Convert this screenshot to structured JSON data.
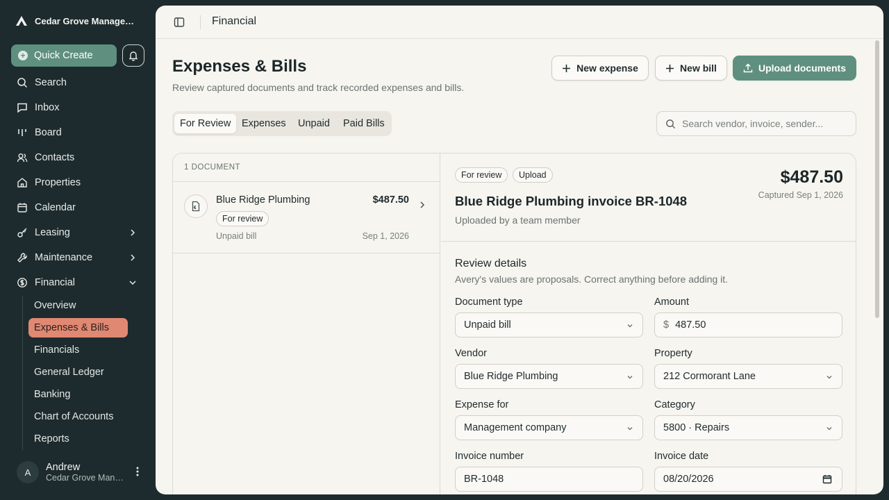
{
  "sidebar": {
    "brand": "Cedar Grove Management",
    "quick_create": "Quick Create",
    "nav": [
      {
        "label": "Search",
        "icon": "search-icon"
      },
      {
        "label": "Inbox",
        "icon": "inbox-icon"
      },
      {
        "label": "Board",
        "icon": "board-icon"
      },
      {
        "label": "Contacts",
        "icon": "contacts-icon"
      },
      {
        "label": "Properties",
        "icon": "home-icon"
      },
      {
        "label": "Calendar",
        "icon": "calendar-icon"
      },
      {
        "label": "Leasing",
        "icon": "key-icon"
      },
      {
        "label": "Maintenance",
        "icon": "wrench-icon"
      },
      {
        "label": "Financial",
        "icon": "dollar-icon"
      }
    ],
    "financial_sub": [
      "Overview",
      "Expenses & Bills",
      "Financials",
      "General Ledger",
      "Banking",
      "Chart of Accounts",
      "Reports"
    ],
    "user": {
      "initial": "A",
      "name": "Andrew",
      "org": "Cedar Grove Management"
    }
  },
  "topbar": {
    "title": "Financial"
  },
  "page": {
    "title": "Expenses & Bills",
    "subtitle": "Review captured documents and track recorded expenses and bills.",
    "buttons": {
      "new_expense": "New expense",
      "new_bill": "New bill",
      "upload": "Upload documents"
    },
    "tabs": [
      "For Review",
      "Expenses",
      "Unpaid",
      "Paid Bills"
    ],
    "search_placeholder": "Search vendor, invoice, sender..."
  },
  "list": {
    "header": "1 DOCUMENT",
    "items": [
      {
        "vendor": "Blue Ridge Plumbing",
        "amount": "$487.50",
        "status": "For review",
        "type": "Unpaid bill",
        "date": "Sep 1, 2026"
      }
    ]
  },
  "detail": {
    "badges": [
      "For review",
      "Upload"
    ],
    "title": "Blue Ridge Plumbing invoice BR-1048",
    "uploader": "Uploaded by a team member",
    "amount": "$487.50",
    "captured": "Captured Sep 1, 2026",
    "section_title": "Review details",
    "section_sub": "Avery's values are proposals. Correct anything before adding it.",
    "fields": {
      "document_type": {
        "label": "Document type",
        "value": "Unpaid bill"
      },
      "amount": {
        "label": "Amount",
        "prefix": "$",
        "value": "487.50"
      },
      "vendor": {
        "label": "Vendor",
        "value": "Blue Ridge Plumbing"
      },
      "property": {
        "label": "Property",
        "value": "212 Cormorant Lane"
      },
      "expense_for": {
        "label": "Expense for",
        "value": "Management company"
      },
      "category": {
        "label": "Category",
        "value": "5800 · Repairs"
      },
      "invoice_number": {
        "label": "Invoice number",
        "value": "BR-1048"
      },
      "invoice_date": {
        "label": "Invoice date",
        "value": "08/20/2026"
      }
    }
  },
  "colors": {
    "accent": "#5f8f7f",
    "active_nav": "#e08872",
    "sidebar_bg": "#1e2b2e",
    "panel_bg": "#f6f5f0"
  }
}
